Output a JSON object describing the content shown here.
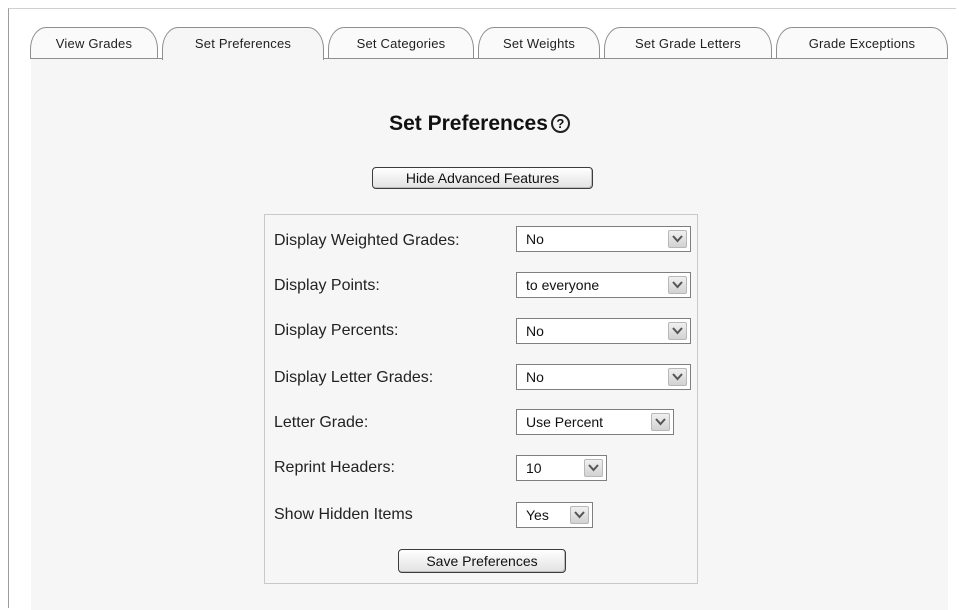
{
  "tabs": [
    {
      "label": "View Grades"
    },
    {
      "label": "Set Preferences"
    },
    {
      "label": "Set Categories"
    },
    {
      "label": "Set Weights"
    },
    {
      "label": "Set Grade Letters"
    },
    {
      "label": "Grade Exceptions"
    }
  ],
  "active_tab": "Set Preferences",
  "page_title": "Set Preferences",
  "help_icon_glyph": "?",
  "hide_advanced_button": "Hide Advanced Features",
  "preferences": [
    {
      "label": "Display Weighted Grades:",
      "value": "No"
    },
    {
      "label": "Display Points:",
      "value": "to everyone"
    },
    {
      "label": "Display Percents:",
      "value": "No"
    },
    {
      "label": "Display Letter Grades:",
      "value": "No"
    },
    {
      "label": "Letter Grade:",
      "value": "Use Percent"
    },
    {
      "label": "Reprint Headers:",
      "value": "10"
    },
    {
      "label": "Show Hidden Items",
      "value": "Yes"
    }
  ],
  "save_button": "Save Preferences"
}
